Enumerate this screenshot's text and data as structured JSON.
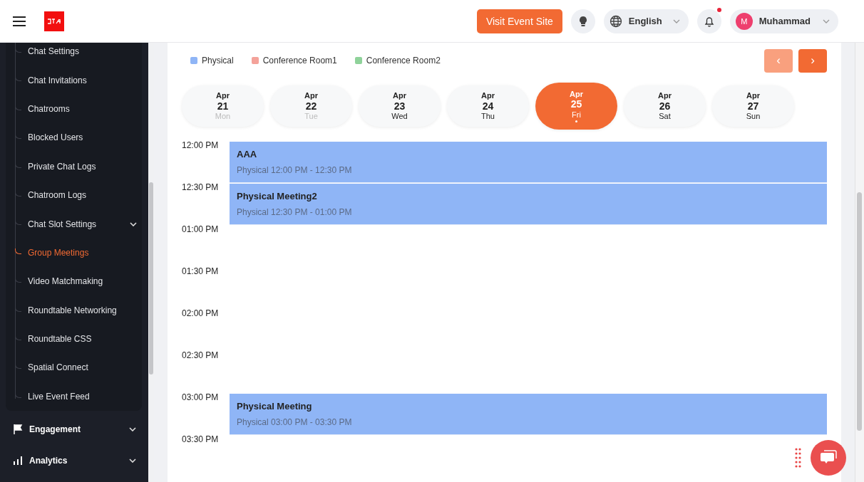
{
  "topbar": {
    "visit_button": "Visit Event Site",
    "language": "English",
    "notification_unread": true,
    "user": {
      "initial": "M",
      "name": "Muhammad"
    }
  },
  "sidebar": {
    "submenu": [
      {
        "label": "Chat Settings",
        "selected": false,
        "expandable": false
      },
      {
        "label": "Chat Invitations",
        "selected": false,
        "expandable": false
      },
      {
        "label": "Chatrooms",
        "selected": false,
        "expandable": false
      },
      {
        "label": "Blocked Users",
        "selected": false,
        "expandable": false
      },
      {
        "label": "Private Chat Logs",
        "selected": false,
        "expandable": false
      },
      {
        "label": "Chatroom Logs",
        "selected": false,
        "expandable": false
      },
      {
        "label": "Chat Slot Settings",
        "selected": false,
        "expandable": true
      },
      {
        "label": "Group Meetings",
        "selected": true,
        "expandable": false
      },
      {
        "label": "Video Matchmaking",
        "selected": false,
        "expandable": false
      },
      {
        "label": "Roundtable Networking",
        "selected": false,
        "expandable": false
      },
      {
        "label": "Roundtable CSS",
        "selected": false,
        "expandable": false
      },
      {
        "label": "Spatial Connect",
        "selected": false,
        "expandable": false
      },
      {
        "label": "Live Event Feed",
        "selected": false,
        "expandable": false
      }
    ],
    "sections": [
      {
        "label": "Engagement",
        "kind": "flag"
      },
      {
        "label": "Analytics",
        "kind": "chart"
      }
    ]
  },
  "legend": [
    {
      "label": "Physical",
      "color": "#8fb5f6"
    },
    {
      "label": "Conference Room1",
      "color": "#f4a29a"
    },
    {
      "label": "Conference Room2",
      "color": "#8fd29a"
    }
  ],
  "nav": {
    "prev_disabled": true,
    "prev": "‹",
    "next": "›"
  },
  "days": [
    {
      "month": "Apr",
      "day": "21",
      "weekday": "Mon",
      "selected": false,
      "disabled": true
    },
    {
      "month": "Apr",
      "day": "22",
      "weekday": "Tue",
      "selected": false,
      "disabled": true
    },
    {
      "month": "Apr",
      "day": "23",
      "weekday": "Wed",
      "selected": false,
      "disabled": false
    },
    {
      "month": "Apr",
      "day": "24",
      "weekday": "Thu",
      "selected": false,
      "disabled": false
    },
    {
      "month": "Apr",
      "day": "25",
      "weekday": "Fri",
      "selected": true,
      "disabled": false
    },
    {
      "month": "Apr",
      "day": "26",
      "weekday": "Sat",
      "selected": false,
      "disabled": false
    },
    {
      "month": "Apr",
      "day": "27",
      "weekday": "Sun",
      "selected": false,
      "disabled": false
    }
  ],
  "slots": [
    {
      "time": "12:00 PM",
      "events": [
        {
          "title": "AAA",
          "detail": "Physical 12:00 PM - 12:30 PM",
          "color": "#8fb5f6"
        }
      ]
    },
    {
      "time": "12:30 PM",
      "events": [
        {
          "title": "Physical Meeting2",
          "detail": "Physical 12:30 PM - 01:00 PM",
          "color": "#8fb5f6"
        }
      ]
    },
    {
      "time": "01:00 PM"
    },
    {
      "time": "01:30 PM"
    },
    {
      "time": "02:00 PM"
    },
    {
      "time": "02:30 PM"
    },
    {
      "time": "03:00 PM",
      "events": [
        {
          "title": "Physical Meeting",
          "detail": "Physical 03:00 PM - 03:30 PM",
          "color": "#8fb5f6"
        }
      ]
    },
    {
      "time": "03:30 PM"
    }
  ]
}
